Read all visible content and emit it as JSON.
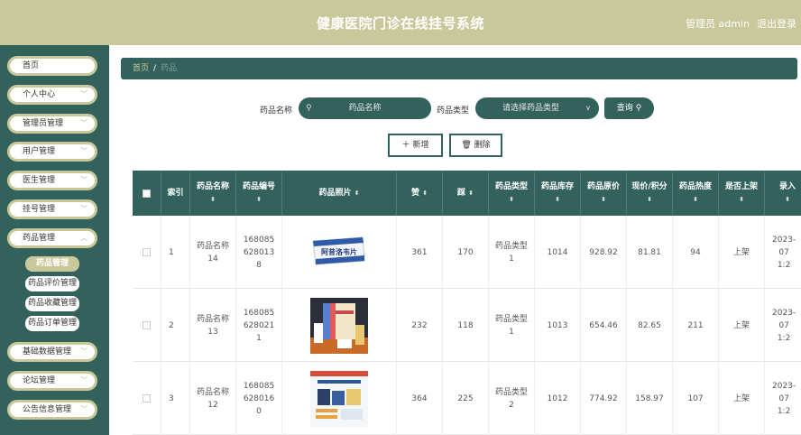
{
  "header": {
    "title": "健康医院门诊在线挂号系统",
    "user": "管理员 admin",
    "logout": "退出登录"
  },
  "sidebar": {
    "items": [
      {
        "label": "首页",
        "chevron": false
      },
      {
        "label": "个人中心",
        "chevron": true
      },
      {
        "label": "管理员管理",
        "chevron": true
      },
      {
        "label": "用户管理",
        "chevron": true
      },
      {
        "label": "医生管理",
        "chevron": true
      },
      {
        "label": "挂号管理",
        "chevron": true
      },
      {
        "label": "药品管理",
        "chevron": true
      }
    ],
    "sub_items": [
      {
        "label": "药品管理",
        "active": true
      },
      {
        "label": "药品评价管理",
        "active": false
      },
      {
        "label": "药品收藏管理",
        "active": false
      },
      {
        "label": "药品订单管理",
        "active": false
      }
    ],
    "lower_items": [
      {
        "label": "基础数据管理",
        "chevron": true
      },
      {
        "label": "论坛管理",
        "chevron": true
      },
      {
        "label": "公告信息管理",
        "chevron": true
      }
    ]
  },
  "breadcrumb": {
    "home": "首页",
    "separator": "/",
    "current": "药品"
  },
  "search": {
    "name_label": "药品名称",
    "name_placeholder": "药品名称",
    "type_label": "药品类型",
    "type_placeholder": "请选择药品类型",
    "query_button": "查询"
  },
  "actions": {
    "add_button": "新增",
    "delete_button": "删除"
  },
  "table": {
    "columns": [
      "索引",
      "药品名称",
      "药品编号",
      "药品照片",
      "赞",
      "踩",
      "药品类型",
      "药品库存",
      "药品原价",
      "现价/积分",
      "药品热度",
      "是否上架",
      "录入"
    ],
    "rows": [
      {
        "index": "1",
        "name": "药品名称14",
        "code": "1680856280138",
        "likes": "361",
        "dislikes": "170",
        "type": "药品类型1",
        "stock": "1014",
        "orig_price": "928.92",
        "price": "81.81",
        "heat": "94",
        "on_shelf": "上架",
        "date": "2023-07 1:2",
        "photo_text": "阿昔洛韦片"
      },
      {
        "index": "2",
        "name": "药品名称13",
        "code": "1680856280211",
        "likes": "232",
        "dislikes": "118",
        "type": "药品类型1",
        "stock": "1013",
        "orig_price": "654.46",
        "price": "82.65",
        "heat": "211",
        "on_shelf": "上架",
        "date": "2023-07 1:2",
        "photo_text": ""
      },
      {
        "index": "3",
        "name": "药品名称12",
        "code": "1680856280160",
        "likes": "364",
        "dislikes": "225",
        "type": "药品类型2",
        "stock": "1012",
        "orig_price": "774.92",
        "price": "158.97",
        "heat": "107",
        "on_shelf": "上架",
        "date": "2023-07 1:2",
        "photo_text": ""
      }
    ]
  },
  "colors": {
    "primary": "#33625d",
    "accent": "#c8c89b",
    "header_text": "#ffffff"
  }
}
